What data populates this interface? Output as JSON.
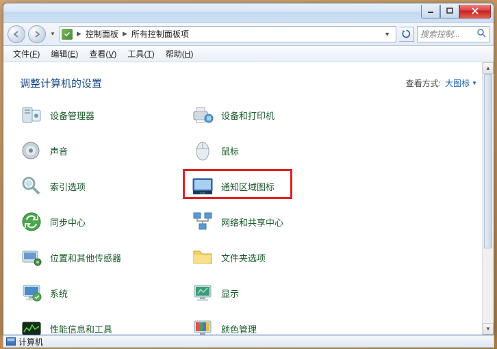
{
  "titlebar": {
    "left1": "",
    "left2": ""
  },
  "breadcrumbs": {
    "root_icon": "control-panel-icon",
    "item1": "控制面板",
    "item2": "所有控制面板项"
  },
  "search": {
    "placeholder": "搜索控制..."
  },
  "menus": [
    {
      "label": "文件",
      "key": "F"
    },
    {
      "label": "编辑",
      "key": "E"
    },
    {
      "label": "查看",
      "key": "V"
    },
    {
      "label": "工具",
      "key": "T"
    },
    {
      "label": "帮助",
      "key": "H"
    }
  ],
  "heading": "调整计算机的设置",
  "view_by_label": "查看方式:",
  "view_by_value": "大图标",
  "items": [
    {
      "label": "设备管理器",
      "icon": "device-manager"
    },
    {
      "label": "设备和打印机",
      "icon": "devices-printers"
    },
    {
      "label": "声音",
      "icon": "sound"
    },
    {
      "label": "鼠标",
      "icon": "mouse"
    },
    {
      "label": "索引选项",
      "icon": "indexing"
    },
    {
      "label": "通知区域图标",
      "icon": "notification-area",
      "highlighted": true
    },
    {
      "label": "同步中心",
      "icon": "sync-center"
    },
    {
      "label": "网络和共享中心",
      "icon": "network-sharing"
    },
    {
      "label": "位置和其他传感器",
      "icon": "location-sensors"
    },
    {
      "label": "文件夹选项",
      "icon": "folder-options"
    },
    {
      "label": "系统",
      "icon": "system"
    },
    {
      "label": "显示",
      "icon": "display"
    },
    {
      "label": "性能信息和工具",
      "icon": "performance"
    },
    {
      "label": "颜色管理",
      "icon": "color-management"
    }
  ],
  "statusbar": {
    "text": "计算机"
  }
}
